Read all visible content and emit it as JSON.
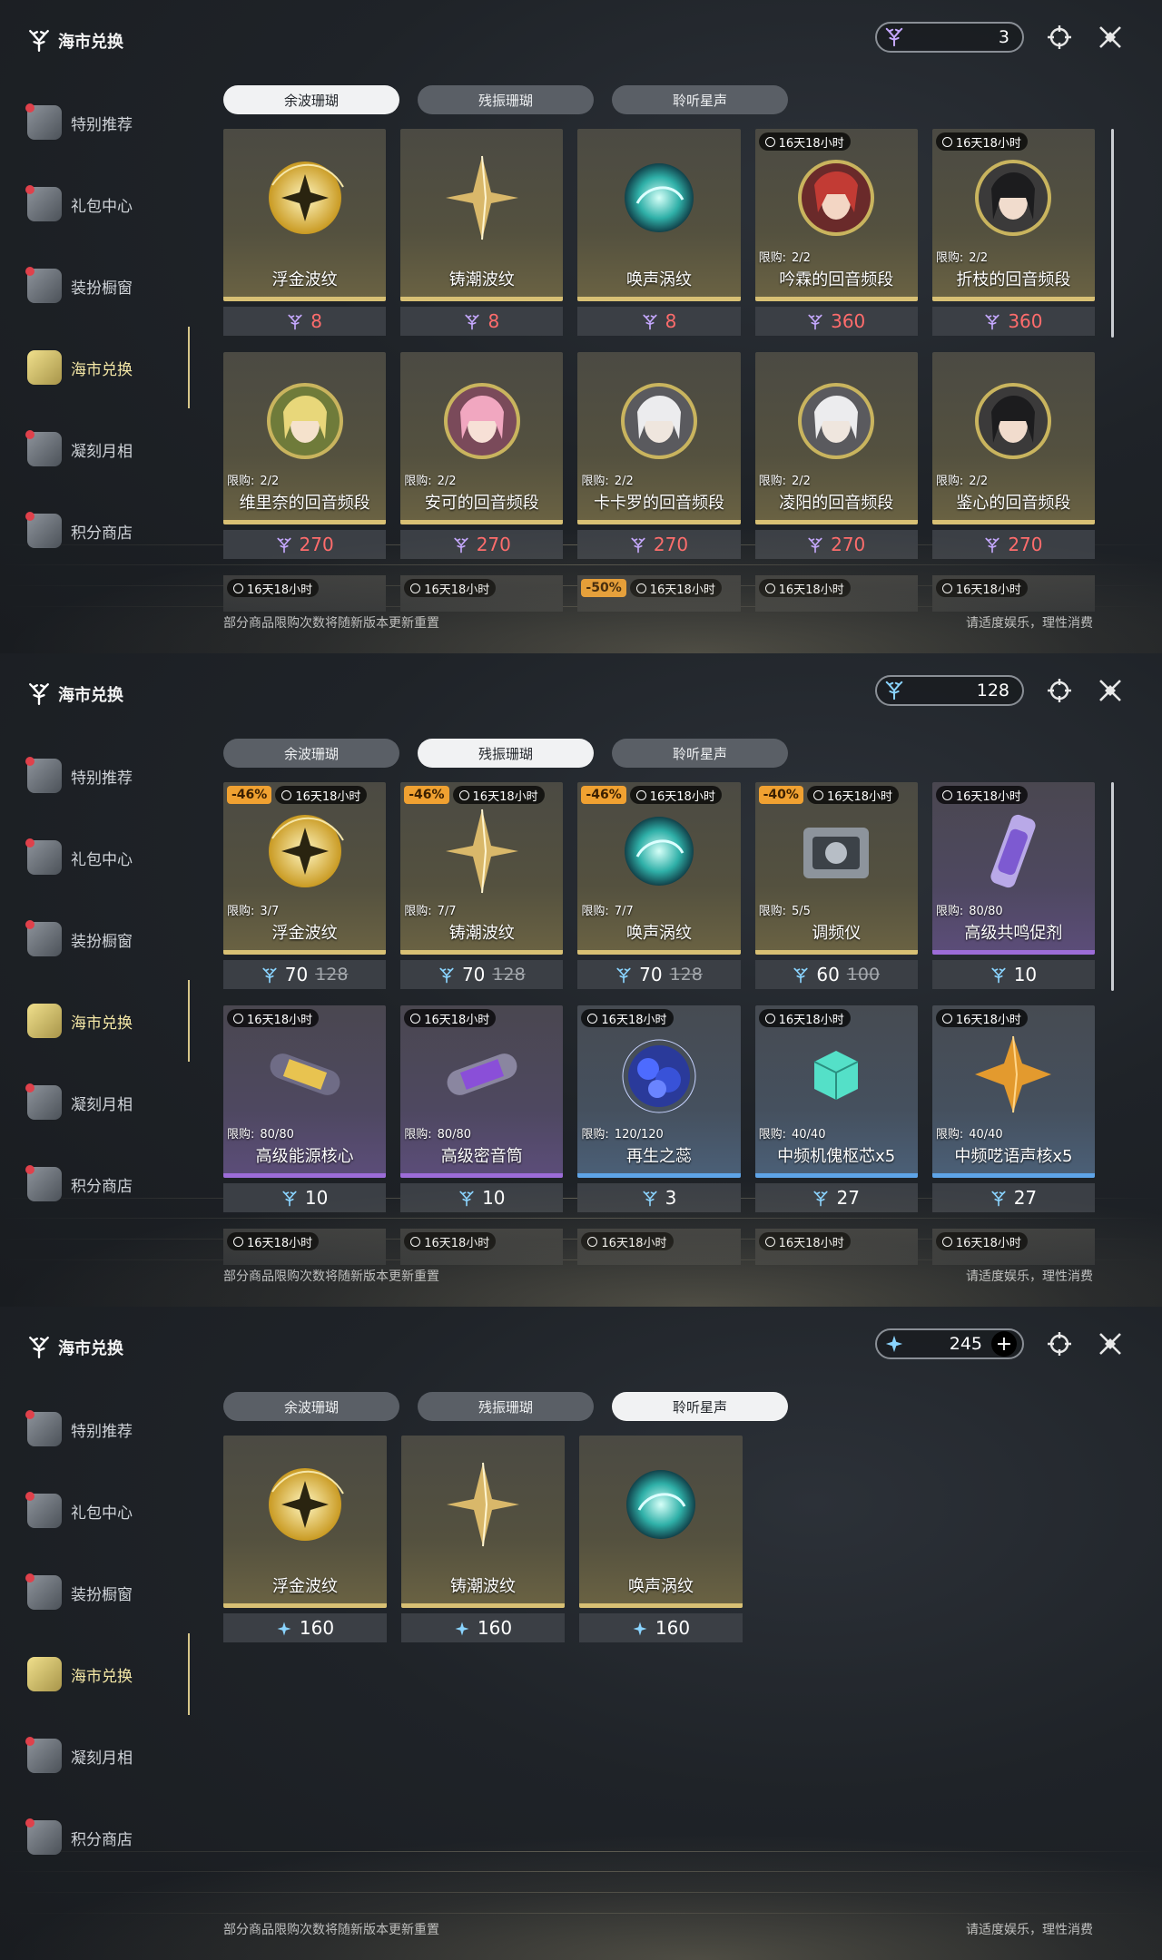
{
  "brand_title": "海市兑换",
  "nav": [
    "特别推荐",
    "礼包中心",
    "装扮橱窗",
    "海市兑换",
    "凝刻月相",
    "积分商店"
  ],
  "tabs": [
    "余波珊瑚",
    "残振珊瑚",
    "聆听星声"
  ],
  "footnote": "部分商品限购次数将随新版本更新重置",
  "footright": "请适度娱乐，理性消费",
  "timer_text": "16天18小时",
  "panels": [
    {
      "currency": "3",
      "active_tab": 0,
      "rows": [
        [
          {
            "name": "浮金波纹",
            "price": "8",
            "price_red": true,
            "art": "orb-gold"
          },
          {
            "name": "铸潮波纹",
            "price": "8",
            "price_red": true,
            "art": "blade"
          },
          {
            "name": "唤声涡纹",
            "price": "8",
            "price_red": true,
            "art": "orb-teal"
          },
          {
            "name": "吟霖的回音频段",
            "price": "360",
            "price_red": true,
            "timer": "16天18小时",
            "limit_label": "限购:",
            "limit": "2/2",
            "art": "portrait-red"
          },
          {
            "name": "折枝的回音频段",
            "price": "360",
            "price_red": true,
            "timer": "16天18小时",
            "limit_label": "限购:",
            "limit": "2/2",
            "art": "portrait-dark"
          }
        ],
        [
          {
            "name": "维里奈的回音频段",
            "price": "270",
            "price_red": true,
            "limit_label": "限购:",
            "limit": "2/2",
            "art": "portrait-green"
          },
          {
            "name": "安可的回音频段",
            "price": "270",
            "price_red": true,
            "limit_label": "限购:",
            "limit": "2/2",
            "art": "portrait-pink"
          },
          {
            "name": "卡卡罗的回音频段",
            "price": "270",
            "price_red": true,
            "limit_label": "限购:",
            "limit": "2/2",
            "art": "portrait-white"
          },
          {
            "name": "凌阳的回音频段",
            "price": "270",
            "price_red": true,
            "limit_label": "限购:",
            "limit": "2/2",
            "art": "portrait-white"
          },
          {
            "name": "鉴心的回音频段",
            "price": "270",
            "price_red": true,
            "limit_label": "限购:",
            "limit": "2/2",
            "art": "portrait-dark"
          }
        ]
      ],
      "peek": [
        {
          "timer": "16天18小时"
        },
        {
          "timer": "16天18小时"
        },
        {
          "discount": "-50%",
          "timer": "16天18小时"
        },
        {
          "timer": "16天18小时"
        },
        {
          "timer": "16天18小时"
        }
      ]
    },
    {
      "currency": "128",
      "active_tab": 1,
      "rows": [
        [
          {
            "name": "浮金波纹",
            "discount": "-46%",
            "timer": "16天18小时",
            "limit_label": "限购:",
            "limit": "3/7",
            "price": "70",
            "orig": "128",
            "art": "orb-gold"
          },
          {
            "name": "铸潮波纹",
            "discount": "-46%",
            "timer": "16天18小时",
            "limit_label": "限购:",
            "limit": "7/7",
            "price": "70",
            "orig": "128",
            "art": "blade"
          },
          {
            "name": "唤声涡纹",
            "discount": "-46%",
            "timer": "16天18小时",
            "limit_label": "限购:",
            "limit": "7/7",
            "price": "70",
            "orig": "128",
            "art": "orb-teal"
          },
          {
            "name": "调频仪",
            "discount": "-40%",
            "timer": "16天18小时",
            "limit_label": "限购:",
            "limit": "5/5",
            "price": "60",
            "orig": "100",
            "art": "device"
          },
          {
            "name": "高级共鸣促剂",
            "timer": "16天18小时",
            "limit_label": "限购:",
            "limit": "80/80",
            "price": "10",
            "rarity": "purple",
            "art": "vial"
          }
        ],
        [
          {
            "name": "高级能源核心",
            "timer": "16天18小时",
            "limit_label": "限购:",
            "limit": "80/80",
            "price": "10",
            "rarity": "purple",
            "art": "capsule-gold"
          },
          {
            "name": "高级密音筒",
            "timer": "16天18小时",
            "limit_label": "限购:",
            "limit": "80/80",
            "price": "10",
            "rarity": "purple",
            "art": "capsule-purple"
          },
          {
            "name": "再生之蕊",
            "timer": "16天18小时",
            "limit_label": "限购:",
            "limit": "120/120",
            "price": "3",
            "rarity": "blue",
            "art": "cluster"
          },
          {
            "name": "中频机傀枢芯x5",
            "timer": "16天18小时",
            "limit_label": "限购:",
            "limit": "40/40",
            "price": "27",
            "rarity": "blue",
            "art": "cube"
          },
          {
            "name": "中频呓语声核x5",
            "timer": "16天18小时",
            "limit_label": "限购:",
            "limit": "40/40",
            "price": "27",
            "rarity": "blue",
            "art": "star"
          }
        ]
      ],
      "peek": [
        {
          "timer": "16天18小时"
        },
        {
          "timer": "16天18小时"
        },
        {
          "timer": "16天18小时"
        },
        {
          "timer": "16天18小时"
        },
        {
          "timer": "16天18小时"
        }
      ]
    },
    {
      "currency": "245",
      "currency_plus": "+",
      "active_tab": 2,
      "rows": [
        [
          {
            "name": "浮金波纹",
            "price": "160",
            "art": "orb-gold"
          },
          {
            "name": "铸潮波纹",
            "price": "160",
            "art": "blade"
          },
          {
            "name": "唤声涡纹",
            "price": "160",
            "art": "orb-teal"
          }
        ]
      ],
      "peek": []
    }
  ],
  "icons": {
    "coral_currency": "coral-icon",
    "star_currency": "star-currency-icon",
    "target": "target-icon",
    "close": "close-icon",
    "clock": "clock-icon"
  },
  "colors": {
    "accent_gold": "#d8c074",
    "price_red": "#ff6c6c",
    "discount": "#f0a131",
    "purple": "#9c6cd8",
    "blue": "#5ea4e8"
  }
}
